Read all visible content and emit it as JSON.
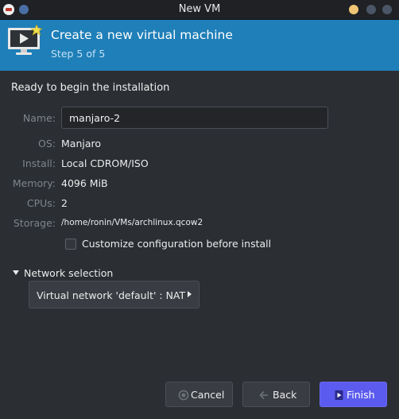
{
  "window": {
    "title": "New VM",
    "controls": [
      {
        "name": "minimize",
        "color": "#f0c674"
      },
      {
        "name": "maximize",
        "color": "#4a5566"
      },
      {
        "name": "close",
        "color": "#4a5566"
      }
    ],
    "menu_dot_color": "#4a6fa5"
  },
  "banner": {
    "title": "Create a new virtual machine",
    "step": "Step 5 of 5",
    "background": "#1f7fb8",
    "icon": "monitor-star-icon"
  },
  "summary": {
    "heading": "Ready to begin the installation",
    "name": {
      "label": "Name:",
      "value": "manjaro-2"
    },
    "os": {
      "label": "OS:",
      "value": "Manjaro"
    },
    "install": {
      "label": "Install:",
      "value": "Local CDROM/ISO"
    },
    "memory": {
      "label": "Memory:",
      "value": "4096 MiB"
    },
    "cpus": {
      "label": "CPUs:",
      "value": "2"
    },
    "storage": {
      "label": "Storage:",
      "value": "/home/ronin/VMs/archlinux.qcow2"
    },
    "customize": {
      "label": "Customize configuration before install",
      "checked": false
    }
  },
  "network": {
    "expander_label": "Network selection",
    "expanded": true,
    "selected": "Virtual network 'default' : NAT"
  },
  "buttons": {
    "cancel": "Cancel",
    "back": "Back",
    "finish": "Finish",
    "finish_color": "#5b5bef"
  }
}
